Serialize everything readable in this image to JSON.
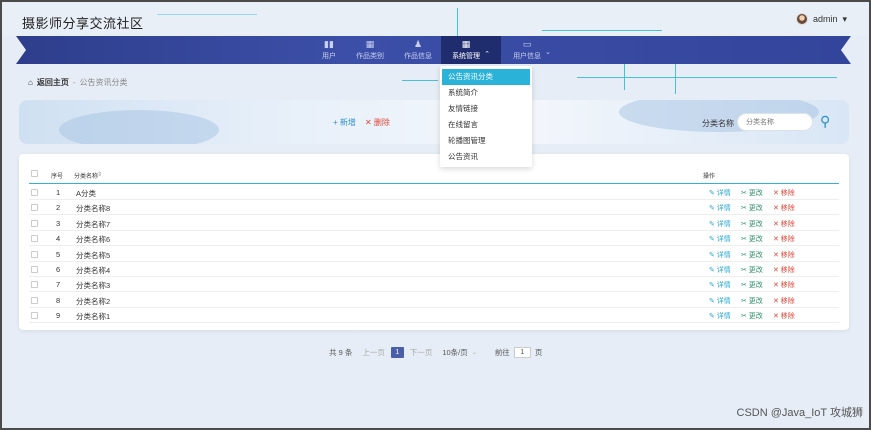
{
  "header": {
    "title": "摄影师分享交流社区",
    "user": "admin",
    "user_caret": "▾"
  },
  "nav": {
    "items": [
      {
        "icon": "▮▮",
        "label": "用户"
      },
      {
        "icon": "▦",
        "label": "作品类别"
      },
      {
        "icon": "♟",
        "label": "作品信息"
      },
      {
        "icon": "▦",
        "label": "系统管理",
        "caret": "⌃"
      },
      {
        "icon": "▭",
        "label": "用户信息",
        "caret": "⌄"
      }
    ]
  },
  "dropdown": {
    "items": [
      "公告资讯分类",
      "系统简介",
      "友情链接",
      "在线留言",
      "轮播图管理",
      "公告资讯"
    ],
    "selected": "公告资讯分类"
  },
  "breadcrumb": {
    "home": "返回主页",
    "sep": "-",
    "current": "公告资讯分类"
  },
  "toolbar": {
    "add": "+ 新增",
    "delete": "✕ 删除",
    "search_label": "分类名称",
    "search_placeholder": "分类名称"
  },
  "table": {
    "headers": {
      "index": "序号",
      "name": "分类名称",
      "sort": "⇕",
      "actions": "操作"
    },
    "action_labels": {
      "detail": "✎ 详情",
      "edit": "✂ 更改",
      "remove": "✕ 移除"
    },
    "rows": [
      {
        "index": "1",
        "name": "A分类"
      },
      {
        "index": "2",
        "name": "分类名称8"
      },
      {
        "index": "3",
        "name": "分类名称7"
      },
      {
        "index": "4",
        "name": "分类名称6"
      },
      {
        "index": "5",
        "name": "分类名称5"
      },
      {
        "index": "6",
        "name": "分类名称4"
      },
      {
        "index": "7",
        "name": "分类名称3"
      },
      {
        "index": "8",
        "name": "分类名称2"
      },
      {
        "index": "9",
        "name": "分类名称1"
      }
    ]
  },
  "pagination": {
    "total": "共 9 条",
    "prev": "上一页",
    "page": "1",
    "next": "下一页",
    "page_size": "10条/页",
    "goto_label": "前往",
    "goto_value": "1",
    "page_unit": "页"
  },
  "watermark": "CSDN @Java_IoT 攻城狮",
  "colors": {
    "nav": "#33449b",
    "accent": "#2ab2d8",
    "danger": "#e0473a"
  }
}
